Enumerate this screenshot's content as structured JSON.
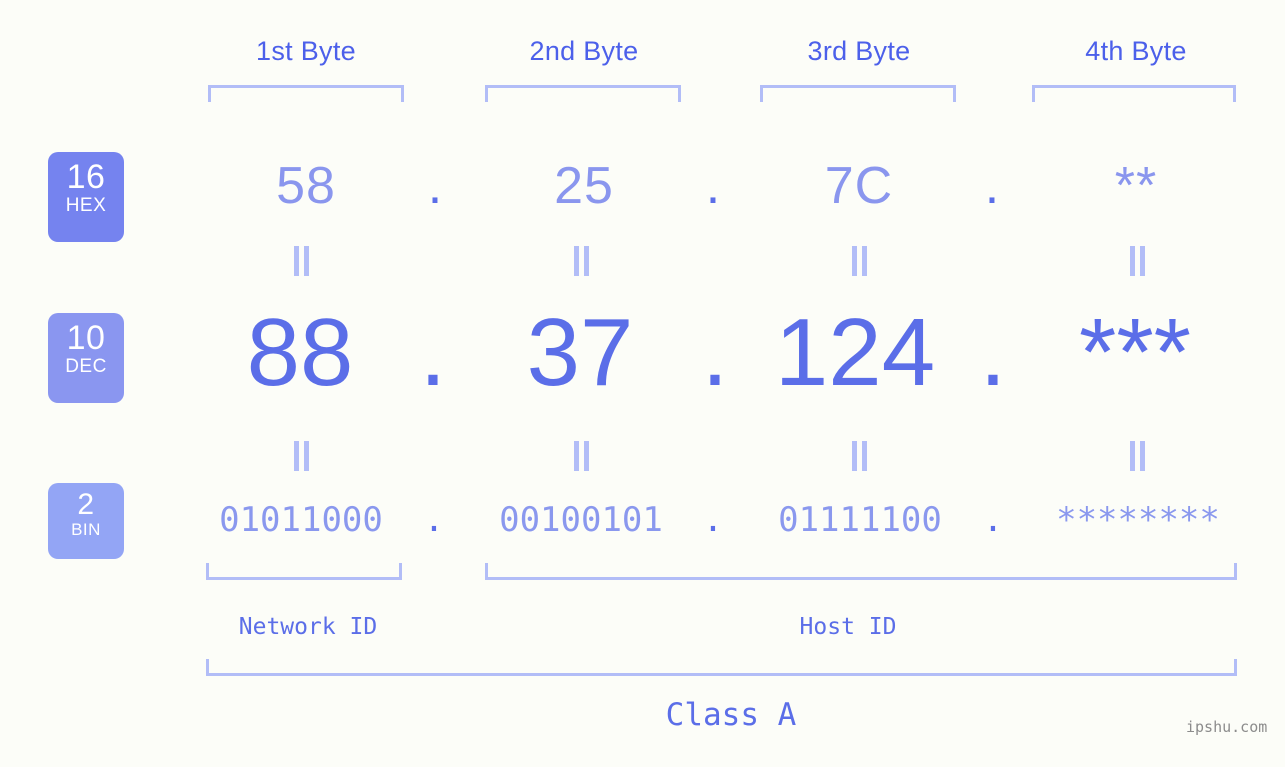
{
  "background_color": "#fcfdf8",
  "byte_headers": [
    {
      "label": "1st Byte"
    },
    {
      "label": "2nd Byte"
    },
    {
      "label": "3rd Byte"
    },
    {
      "label": "4th Byte"
    }
  ],
  "bases": [
    {
      "num": "16",
      "name": "HEX",
      "color": "#7583ef"
    },
    {
      "num": "10",
      "name": "DEC",
      "color": "#8a96f0"
    },
    {
      "num": "2",
      "name": "BIN",
      "color": "#93a5f5"
    }
  ],
  "rows": {
    "hex": {
      "base_num": "16",
      "base_name": "HEX",
      "values": [
        "58",
        "25",
        "7C",
        "**"
      ],
      "separator": "."
    },
    "dec": {
      "base_num": "10",
      "base_name": "DEC",
      "values": [
        "88",
        "37",
        "124",
        "***"
      ],
      "separator": "."
    },
    "bin": {
      "base_num": "2",
      "base_name": "BIN",
      "values": [
        "01011000",
        "00100101",
        "01111100",
        "********"
      ],
      "separator": "."
    }
  },
  "equals_marker": "=",
  "segments": {
    "network_id": "Network ID",
    "host_id": "Host ID",
    "class": "Class A"
  },
  "watermark": "ipshu.com",
  "colors": {
    "header_text": "#4c60ea",
    "bracket": "#b2bdf7",
    "hex_text": "#8a96ee",
    "dec_text": "#5b6ee8",
    "bin_text": "#8a98ee",
    "separator": "#5b6ee8",
    "watermark": "#8c8c8c"
  }
}
